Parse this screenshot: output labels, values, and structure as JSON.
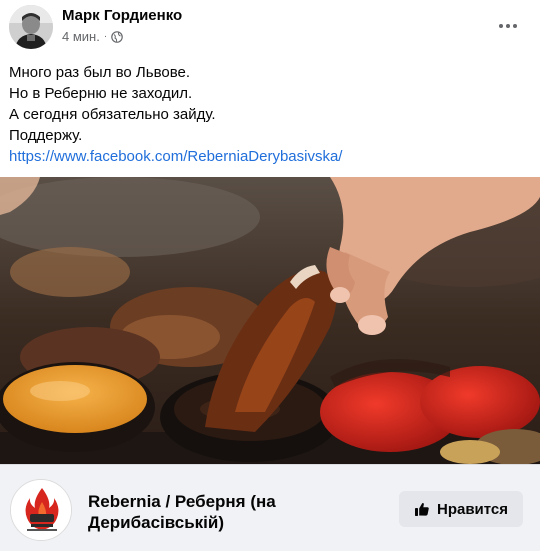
{
  "post": {
    "author_name": "Марк Гордиенко",
    "time_ago": "4 мин.",
    "separator": "·",
    "privacy_icon": "globe-icon",
    "more_icon": "more-options-icon",
    "text_lines": [
      "Много раз был во Львове.",
      "Но в Реберню не заходил.",
      "А сегодня обязательно зайду.",
      "Поддержу."
    ],
    "link_text": "https://www.facebook.com/ReberniaDerybasivska/",
    "photo_description_icon": "food-photo"
  },
  "preview": {
    "page_name": "Rebernia / Реберня (на Дерибасівській)",
    "logo_icon": "rebernia-logo",
    "like_button_label": "Нравится",
    "like_icon": "thumbs-up-icon"
  },
  "colors": {
    "link": "#216fdb",
    "meta_text": "#65676b",
    "preview_bg": "#f0f2f5",
    "button_bg": "#e4e6eb",
    "logo_red": "#d7261e"
  }
}
